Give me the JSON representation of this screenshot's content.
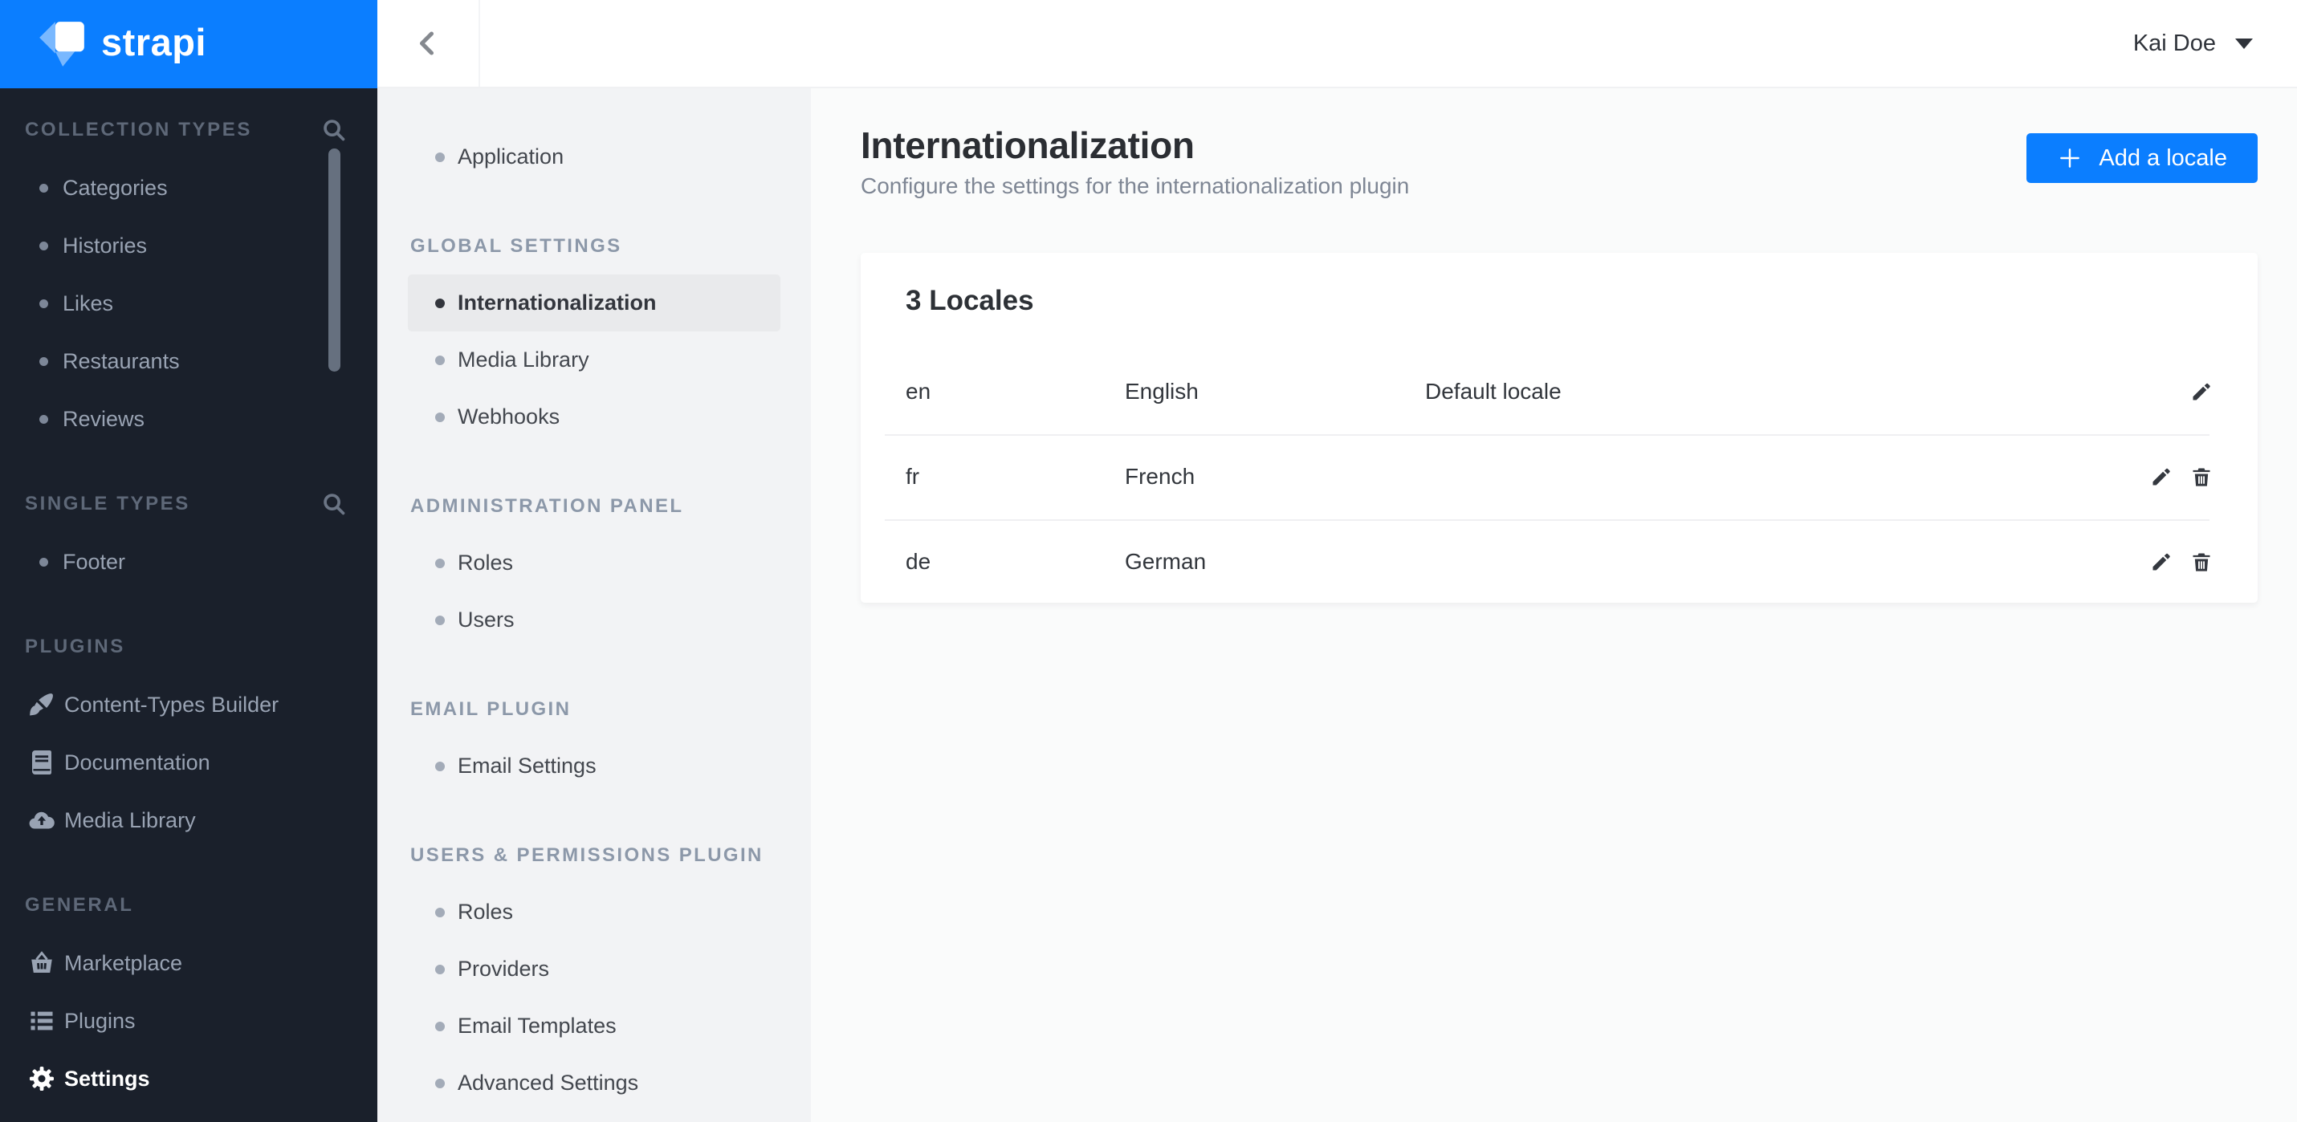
{
  "colors": {
    "brand_blue": "#0B7EFF",
    "accent": "#0B7EFF",
    "sidebar_bg": "#1A202B",
    "sidebar_text": "#99A3B3",
    "sidebar_header_text": "#5E6878",
    "nav_bg": "#F2F3F5",
    "nav_header_text": "#8C98A9",
    "nav_item_text": "#43474E",
    "nav_active_bg": "#E9EAEC",
    "nav_active_text": "#33363D",
    "content_bg": "#FAFBFB",
    "text_dark": "#2F333A",
    "text_gray": "#7E8694"
  },
  "brand": {
    "wordmark": "strapi"
  },
  "topbar": {
    "user_name": "Kai Doe"
  },
  "sidebar": {
    "sections": [
      {
        "label": "COLLECTION TYPES",
        "has_search": true,
        "items": [
          {
            "label": "Categories"
          },
          {
            "label": "Histories"
          },
          {
            "label": "Likes"
          },
          {
            "label": "Restaurants"
          },
          {
            "label": "Reviews"
          }
        ]
      },
      {
        "label": "SINGLE TYPES",
        "has_search": true,
        "items": [
          {
            "label": "Footer"
          }
        ]
      },
      {
        "label": "PLUGINS",
        "items": [
          {
            "label": "Content-Types Builder",
            "icon": "brush-icon"
          },
          {
            "label": "Documentation",
            "icon": "book-icon"
          },
          {
            "label": "Media Library",
            "icon": "cloud-upload-icon"
          }
        ]
      },
      {
        "label": "GENERAL",
        "items": [
          {
            "label": "Marketplace",
            "icon": "basket-icon"
          },
          {
            "label": "Plugins",
            "icon": "list-icon"
          },
          {
            "label": "Settings",
            "icon": "gear-icon",
            "active": true
          }
        ]
      }
    ]
  },
  "settings_nav": {
    "groups": [
      {
        "items": [
          {
            "label": "Application"
          }
        ]
      },
      {
        "header": "GLOBAL SETTINGS",
        "items": [
          {
            "label": "Internationalization",
            "active": true
          },
          {
            "label": "Media Library"
          },
          {
            "label": "Webhooks"
          }
        ]
      },
      {
        "header": "ADMINISTRATION PANEL",
        "items": [
          {
            "label": "Roles"
          },
          {
            "label": "Users"
          }
        ]
      },
      {
        "header": "EMAIL PLUGIN",
        "items": [
          {
            "label": "Email Settings"
          }
        ]
      },
      {
        "header": "USERS & PERMISSIONS PLUGIN",
        "items": [
          {
            "label": "Roles"
          },
          {
            "label": "Providers"
          },
          {
            "label": "Email Templates"
          },
          {
            "label": "Advanced Settings"
          }
        ]
      }
    ]
  },
  "content": {
    "title": "Internationalization",
    "subtitle": "Configure the settings for the internationalization plugin",
    "add_locale_button": "Add a locale",
    "locales": {
      "title": "3 Locales",
      "rows": [
        {
          "code": "en",
          "name": "English",
          "note": "Default locale"
        },
        {
          "code": "fr",
          "name": "French",
          "note": ""
        },
        {
          "code": "de",
          "name": "German",
          "note": ""
        }
      ]
    }
  }
}
